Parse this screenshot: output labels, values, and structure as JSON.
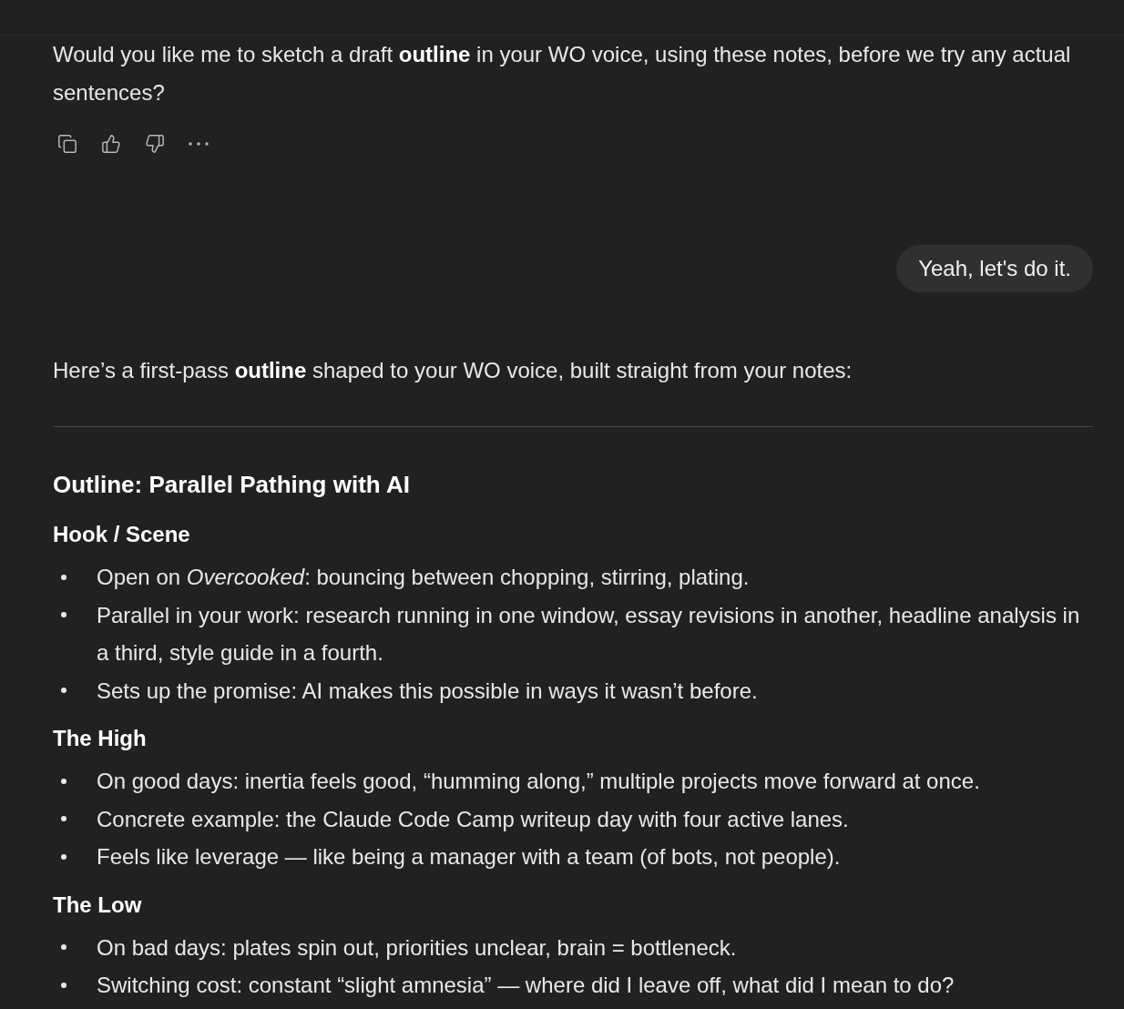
{
  "messages": [
    {
      "kind": "assistant",
      "show_actions": true,
      "blocks": [
        {
          "kind": "paragraph",
          "text": "Would you like me to sketch a draft **outline** in your WO voice, using these notes, before we try any actual sentences?"
        }
      ]
    },
    {
      "kind": "user",
      "text": "Yeah, let's do it."
    },
    {
      "kind": "assistant",
      "show_actions": false,
      "blocks": [
        {
          "kind": "paragraph",
          "text": "Here’s a first-pass **outline** shaped to your WO voice, built straight from your notes:"
        },
        {
          "kind": "divider"
        },
        {
          "kind": "title",
          "text": "Outline: Parallel Pathing with AI"
        },
        {
          "kind": "heading",
          "text": "Hook / Scene"
        },
        {
          "kind": "list",
          "items": [
            "Open on *Overcooked*: bouncing between chopping, stirring, plating.",
            "Parallel in your work: research running in one window, essay revisions in another, headline analysis in a third, style guide in a fourth.",
            "Sets up the promise: AI makes this possible in ways it wasn’t before."
          ]
        },
        {
          "kind": "heading",
          "text": "The High"
        },
        {
          "kind": "list",
          "items": [
            "On good days: inertia feels good, “humming along,” multiple projects move forward at once.",
            "Concrete example: the Claude Code Camp writeup day with four active lanes.",
            "Feels like leverage — like being a manager with a team (of bots, not people)."
          ]
        },
        {
          "kind": "heading",
          "text": "The Low"
        },
        {
          "kind": "list",
          "items": [
            "On bad days: plates spin out, priorities unclear, brain = bottleneck.",
            "Switching cost: constant “slight amnesia” — where did I leave off, what did I mean to do?"
          ]
        }
      ]
    }
  ]
}
